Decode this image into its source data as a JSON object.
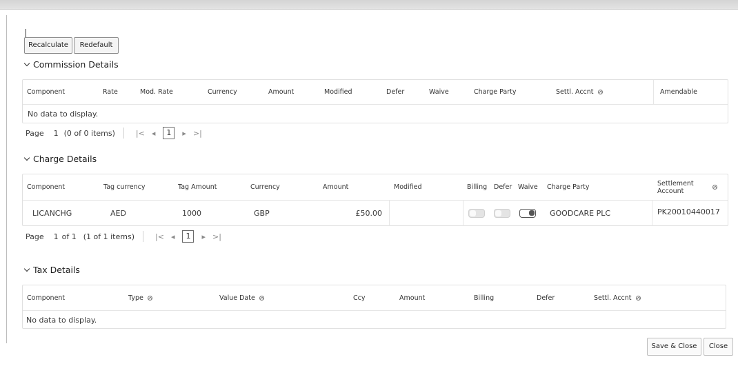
{
  "toolbar": {
    "recalculate_label": "Recalculate",
    "redefault_label": "Redefault"
  },
  "commission": {
    "title": "Commission Details",
    "columns": [
      "Component",
      "Rate",
      "Mod. Rate",
      "Currency",
      "Amount",
      "Modified",
      "Defer",
      "Waive",
      "Charge Party",
      "Settl. Accnt",
      "Amendable"
    ],
    "empty_text": "No data to display.",
    "pager": {
      "page_label": "Page",
      "page_num": "1",
      "items": "(0 of 0 items)",
      "current": "1"
    }
  },
  "charges": {
    "title": "Charge Details",
    "columns": [
      "Component",
      "Tag currency",
      "Tag Amount",
      "Currency",
      "Amount",
      "Modified",
      "Billing",
      "Defer",
      "Waive",
      "Charge Party",
      "Settlement Account"
    ],
    "rows": [
      {
        "component": "LICANCHG",
        "tag_currency": "AED",
        "tag_amount": "1000",
        "currency": "GBP",
        "amount": "£50.00",
        "modified": "",
        "billing": false,
        "defer": false,
        "waive": true,
        "charge_party": "GOODCARE PLC",
        "settlement_account": "PK20010440017"
      }
    ],
    "pager": {
      "page_label": "Page",
      "page_num": "1",
      "of_pages": "of 1",
      "items": "(1 of 1 items)",
      "current": "1"
    }
  },
  "tax": {
    "title": "Tax Details",
    "columns": [
      "Component",
      "Type",
      "Value Date",
      "Ccy",
      "Amount",
      "Billing",
      "Defer",
      "Settl. Accnt"
    ],
    "empty_text": "No data to display."
  },
  "footer": {
    "save_close_label": "Save & Close",
    "close_label": "Close"
  },
  "icons": {
    "section_toggle": "chevron-down-icon",
    "sort": "sort-icon",
    "first": "first-page-icon",
    "prev": "prev-page-icon",
    "next": "next-page-icon",
    "last": "last-page-icon"
  }
}
